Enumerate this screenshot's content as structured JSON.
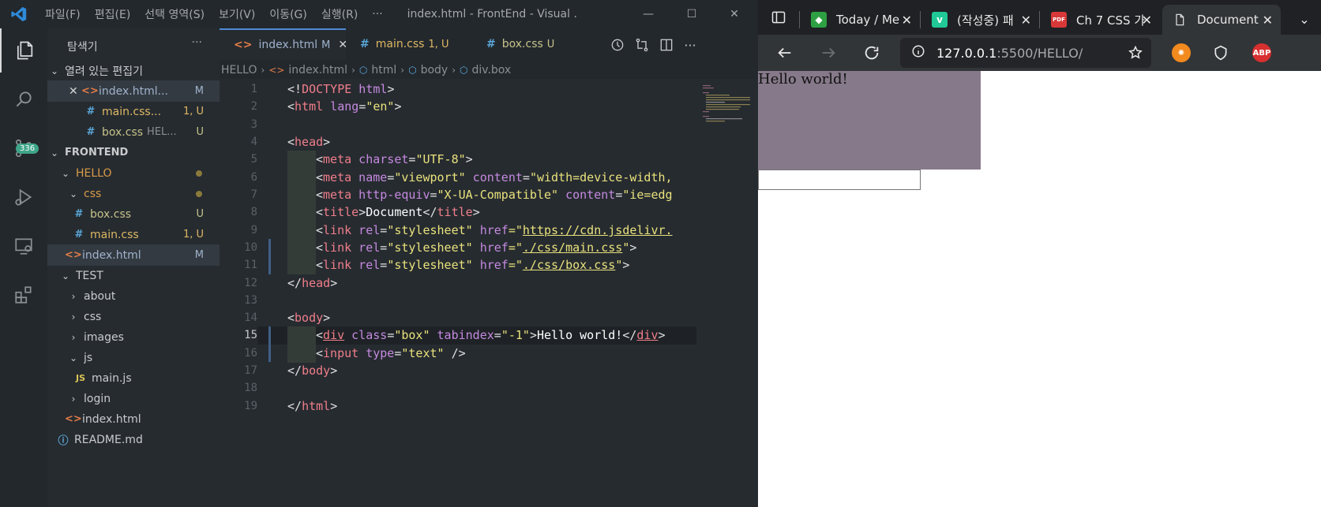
{
  "vscode": {
    "menu": [
      "파일(F)",
      "편집(E)",
      "선택 영역(S)",
      "보기(V)",
      "이동(G)",
      "실행(R)",
      "···"
    ],
    "window_title": "index.html - FrontEnd - Visual ...",
    "window_controls": {
      "minimize": "—",
      "maximize": "☐",
      "close": "✕"
    },
    "activity_bar": {
      "source_control_badge": "336"
    },
    "sidebar": {
      "title": "탐색기",
      "more": "···",
      "open_editors_label": "열려 있는 편집기",
      "open_editors": [
        {
          "close": "✕",
          "icon": "<>",
          "name": "index.html...",
          "status": "M"
        },
        {
          "icon": "#",
          "name": "main.css...",
          "status": "1, U"
        },
        {
          "icon": "#",
          "name": "box.css",
          "desc": "HEL...",
          "status": "U"
        }
      ],
      "workspace_label": "FRONTEND",
      "tree": {
        "hello": "HELLO",
        "css": "css",
        "box_css": {
          "name": "box.css",
          "status": "U"
        },
        "main_css": {
          "name": "main.css",
          "status": "1, U"
        },
        "index_html": {
          "name": "index.html",
          "status": "M"
        },
        "test": "TEST",
        "about": "about",
        "css2": "css",
        "images": "images",
        "js": "js",
        "main_js": {
          "icon": "JS",
          "name": "main.js"
        },
        "login": "login",
        "index_html2": "index.html",
        "readme": "README.md"
      }
    },
    "tabs": [
      {
        "icon": "<>",
        "name": "index.html",
        "status": "M",
        "close": "✕"
      },
      {
        "icon": "#",
        "name": "main.css",
        "status": "1, U"
      },
      {
        "icon": "#",
        "name": "box.css",
        "status": "U"
      }
    ],
    "breadcrumb": [
      "HELLO",
      "index.html",
      "html",
      "body",
      "div.box"
    ],
    "line_numbers": [
      "1",
      "2",
      "3",
      "4",
      "5",
      "6",
      "7",
      "8",
      "9",
      "10",
      "11",
      "12",
      "13",
      "14",
      "15",
      "16",
      "17",
      "18",
      "19"
    ],
    "code": {
      "l1": {
        "a": "<!",
        "b": "DOCTYPE",
        "c": " html",
        "d": ">"
      },
      "l2": {
        "a": "<",
        "b": "html",
        "c": " lang",
        "d": "=",
        "e": "\"en\"",
        "f": ">"
      },
      "l4": {
        "a": "<",
        "b": "head",
        "c": ">"
      },
      "l5": {
        "a": "<",
        "b": "meta",
        "c": " charset",
        "d": "=",
        "e": "\"UTF-8\"",
        "f": ">"
      },
      "l6": {
        "a": "<",
        "b": "meta",
        "c": " name",
        "d": "=",
        "e": "\"viewport\"",
        "f": " content",
        "g": "=",
        "h": "\"width=device-width,"
      },
      "l7": {
        "a": "<",
        "b": "meta",
        "c": " http-equiv",
        "d": "=",
        "e": "\"X-UA-Compatible\"",
        "f": " content",
        "g": "=",
        "h": "\"ie=edg"
      },
      "l8": {
        "a": "<",
        "b": "title",
        "c": ">",
        "d": "Document",
        "e": "</",
        "f": "title",
        "g": ">"
      },
      "l9": {
        "a": "<",
        "b": "link",
        "c": " rel",
        "d": "=",
        "e": "\"stylesheet\"",
        "f": " href",
        "g": "=\"",
        "h": "https://cdn.jsdelivr."
      },
      "l10": {
        "a": "<",
        "b": "link",
        "c": " rel",
        "d": "=",
        "e": "\"stylesheet\"",
        "f": " href",
        "g": "=\"",
        "h": "./css/main.css",
        "i": "\"",
        "j": ">"
      },
      "l11": {
        "a": "<",
        "b": "link",
        "c": " rel",
        "d": "=",
        "e": "\"stylesheet\"",
        "f": " href",
        "g": "=\"",
        "h": "./css/box.css",
        "i": "\"",
        "j": ">"
      },
      "l12": {
        "a": "</",
        "b": "head",
        "c": ">"
      },
      "l14": {
        "a": "<",
        "b": "body",
        "c": ">"
      },
      "l15": {
        "a": "<",
        "b": "div",
        "c": " class",
        "d": "=",
        "e": "\"box\"",
        "f": " tabindex",
        "g": "=",
        "h": "\"-1\"",
        "i": ">",
        "j": "Hello world!",
        "k": "</",
        "l": "div",
        "m": ">"
      },
      "l16": {
        "a": "<",
        "b": "input",
        "c": " type",
        "d": "=",
        "e": "\"text\"",
        "f": " />"
      },
      "l17": {
        "a": "</",
        "b": "body",
        "c": ">"
      },
      "l19": {
        "a": "</",
        "b": "html",
        "c": ">"
      }
    }
  },
  "browser": {
    "tabs": [
      {
        "title": "Today / Me",
        "close": "✕"
      },
      {
        "fav": "v",
        "title": "(작성중) 패",
        "close": "✕"
      },
      {
        "fav": "PDF",
        "title": "Ch 7 CSS 가",
        "close": "✕"
      },
      {
        "title": "Document",
        "close": "✕"
      }
    ],
    "overflow": "⌄",
    "url_host": "127.0.0.1",
    "url_rest": ":5500/HELLO/",
    "extension_abp": "ABP",
    "page": {
      "box_text": "Hello world!",
      "input_value": ""
    }
  },
  "colors": {
    "editor_bg": "#262b30",
    "box_bg": "#867a8a",
    "accent": "#4d8bd6"
  }
}
